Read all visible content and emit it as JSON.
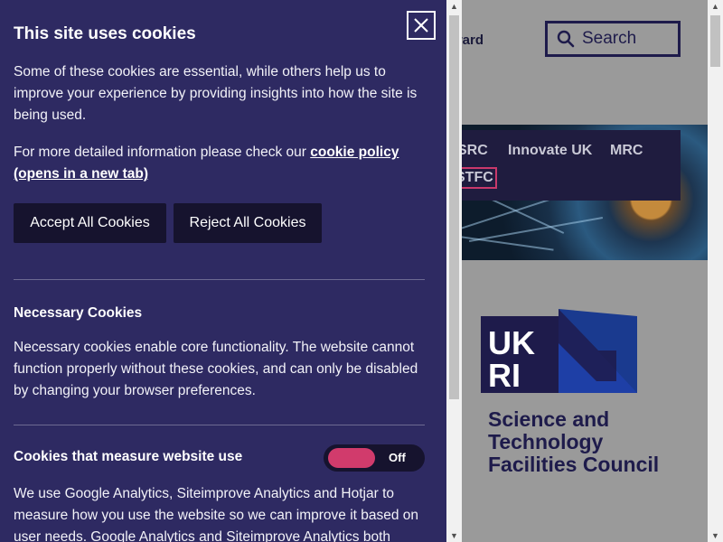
{
  "background_page": {
    "header_link": "ward",
    "search": {
      "label": "Search"
    },
    "nav": [
      "SRC",
      "Innovate UK",
      "MRC",
      "STFC"
    ],
    "logo": {
      "letters": "UKRI",
      "org_name_lines": [
        "Science and",
        "Technology",
        "Facilities Council"
      ]
    }
  },
  "cookie_panel": {
    "title": "This site uses cookies",
    "close_label": "✕",
    "intro": "Some of these cookies are essential, while others help us to improve your experience by providing insights into how the site is being used.",
    "policy_text": "For more detailed information please check our ",
    "policy_link": "cookie policy (opens in a new tab)",
    "accept_label": "Accept All Cookies",
    "reject_label": "Reject All Cookies",
    "necessary": {
      "title": "Necessary Cookies",
      "body": "Necessary cookies enable core functionality. The website cannot function properly without these cookies, and can only be disabled by changing your browser preferences."
    },
    "analytics": {
      "title": "Cookies that measure website use",
      "toggle_state": "Off",
      "body": "We use Google Analytics, Siteimprove Analytics and Hotjar to measure how you use the website so we can improve it based on user needs. Google Analytics and Siteimprove Analytics both"
    }
  },
  "colors": {
    "panel_bg": "#2e2a62",
    "button_bg": "#16132e",
    "toggle_accent": "#d13b6c",
    "brand_navy": "#1e1b4b"
  }
}
